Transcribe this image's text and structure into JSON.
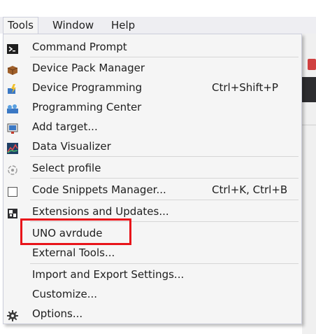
{
  "menubar": {
    "items": [
      {
        "label": "Tools"
      },
      {
        "label": "Window"
      },
      {
        "label": "Help"
      }
    ]
  },
  "menu": {
    "items": [
      {
        "label": "Command Prompt",
        "icon": "command-prompt-icon"
      },
      {
        "label": "Device Pack Manager",
        "icon": "package-icon"
      },
      {
        "label": "Device Programming",
        "shortcut": "Ctrl+Shift+P",
        "icon": "device-programming-icon"
      },
      {
        "label": "Programming Center",
        "icon": "programming-center-icon"
      },
      {
        "label": "Add target...",
        "icon": "add-target-icon"
      },
      {
        "label": "Data Visualizer",
        "icon": "data-visualizer-icon"
      },
      {
        "label": "Select profile",
        "icon": "profile-icon"
      },
      {
        "label": "Code Snippets Manager...",
        "shortcut": "Ctrl+K, Ctrl+B",
        "icon": "code-snippets-icon"
      },
      {
        "label": "Extensions and Updates...",
        "icon": "extensions-icon"
      },
      {
        "label": "UNO avrdude"
      },
      {
        "label": "External Tools..."
      },
      {
        "label": "Import and Export Settings..."
      },
      {
        "label": "Customize..."
      },
      {
        "label": "Options...",
        "icon": "gear-icon"
      }
    ]
  },
  "colors": {
    "highlight_border": "#e8141a",
    "menu_background": "#f5f5f5",
    "menubar_background": "#eeeef2"
  }
}
